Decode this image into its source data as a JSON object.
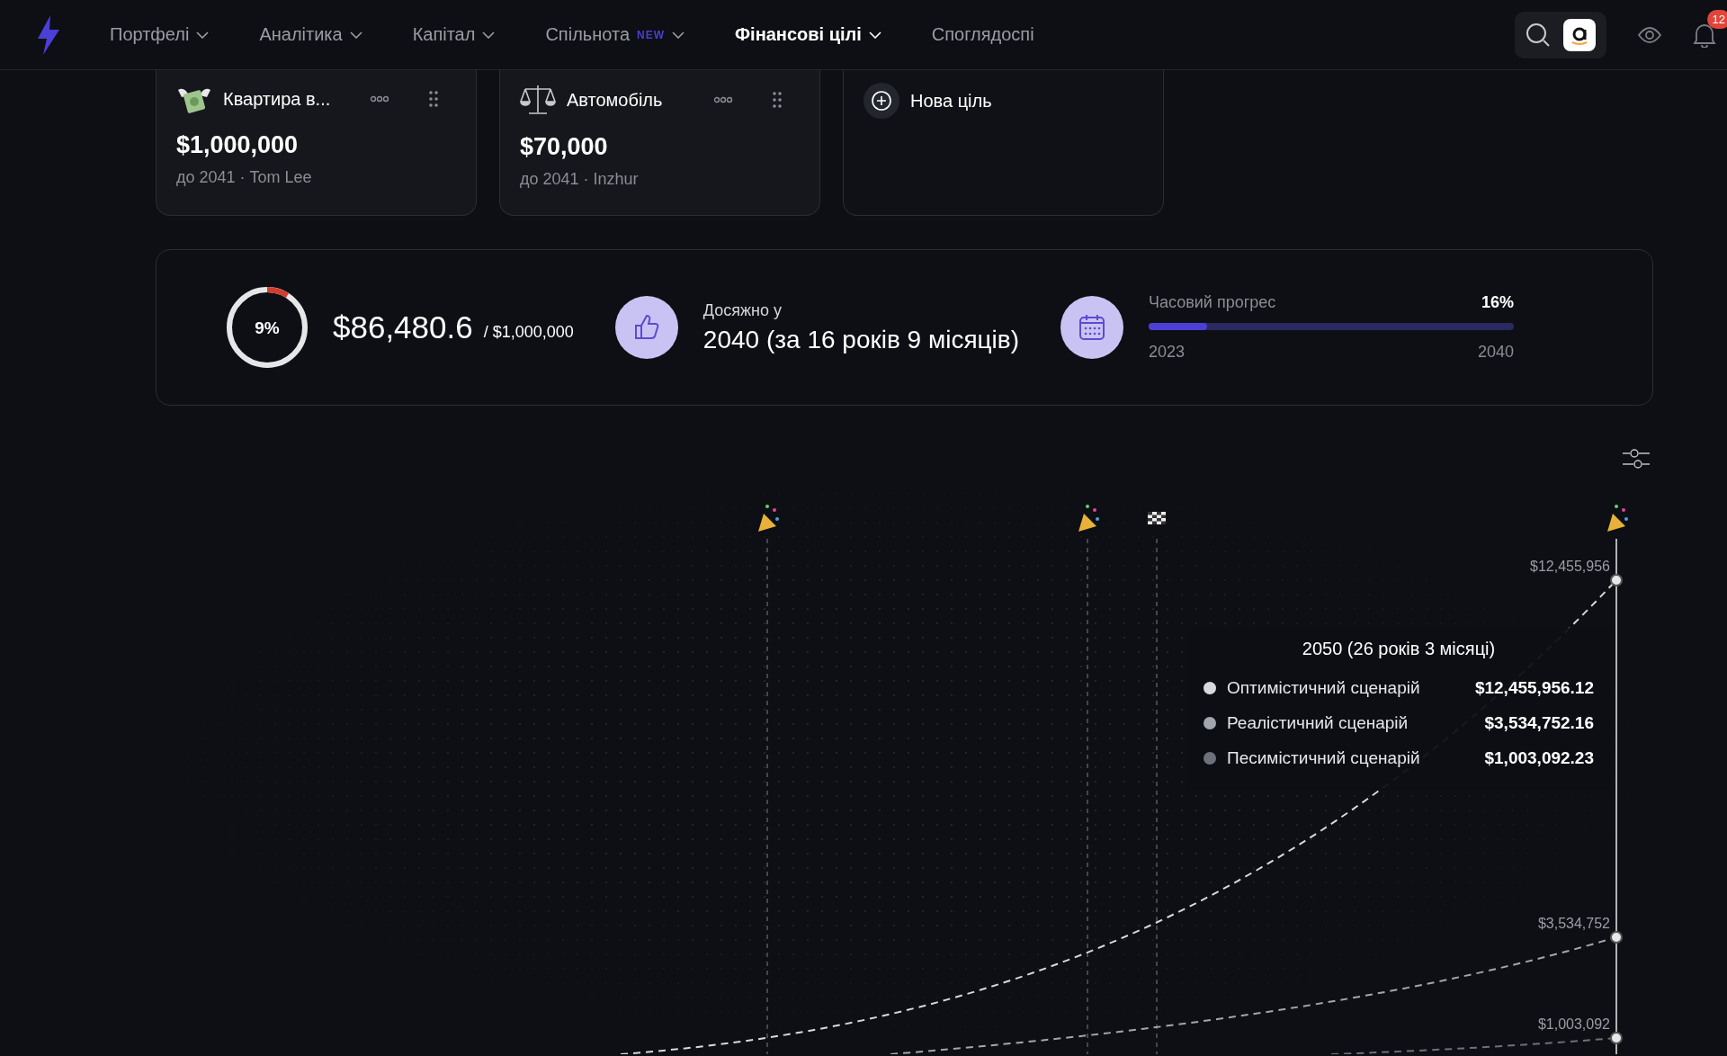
{
  "nav": {
    "items": [
      {
        "label": "Портфелі",
        "dropdown": true,
        "selected": false
      },
      {
        "label": "Аналітика",
        "dropdown": true,
        "selected": false
      },
      {
        "label": "Капітал",
        "dropdown": true,
        "selected": false
      },
      {
        "label": "Спільнота",
        "badge": "NEW",
        "dropdown": true,
        "selected": false
      },
      {
        "label": "Фінансові цілі",
        "dropdown": true,
        "selected": true
      },
      {
        "label": "Споглядоспі",
        "dropdown": false,
        "selected": false
      }
    ],
    "notifications": "12"
  },
  "goals": [
    {
      "kind": "money",
      "title": "Квартира в...",
      "amount": "$1,000,000",
      "subtitle": "до 2041 · Tom Lee"
    },
    {
      "kind": "scales",
      "title": "Автомобіль",
      "amount": "$70,000",
      "subtitle": "до 2041 · Inzhur"
    },
    {
      "kind": "new",
      "title": "Нова ціль"
    }
  ],
  "summary": {
    "percent": "9%",
    "level": 0.09,
    "amount": "$86,480.6",
    "target": "/ $1,000,000",
    "achieved_label": "Досяжно у",
    "achieved_value": "2040 (за 16 років 9 місяців)",
    "time": {
      "label": "Часовий прогрес",
      "percent": "16%",
      "level": 0.16,
      "start": "2023",
      "end": "2040"
    }
  },
  "chart": {
    "markers": [
      {
        "kind": "party"
      },
      {
        "kind": "party"
      },
      {
        "kind": "finish"
      },
      {
        "kind": "party"
      }
    ],
    "point_labels": [
      "$12,455,956",
      "$3,534,752",
      "$1,003,092"
    ],
    "tooltip": {
      "title": "2050 (26 років 3 місяці)",
      "rows": [
        {
          "label": "Оптимістичний сценарій",
          "value": "$12,455,956.12",
          "color": "#d9d9dc"
        },
        {
          "label": "Реалістичний сценарій",
          "value": "$3,534,752.16",
          "color": "#a3a6ad"
        },
        {
          "label": "Песимістичний сценарій",
          "value": "$1,003,092.23",
          "color": "#6d717a"
        }
      ]
    }
  }
}
